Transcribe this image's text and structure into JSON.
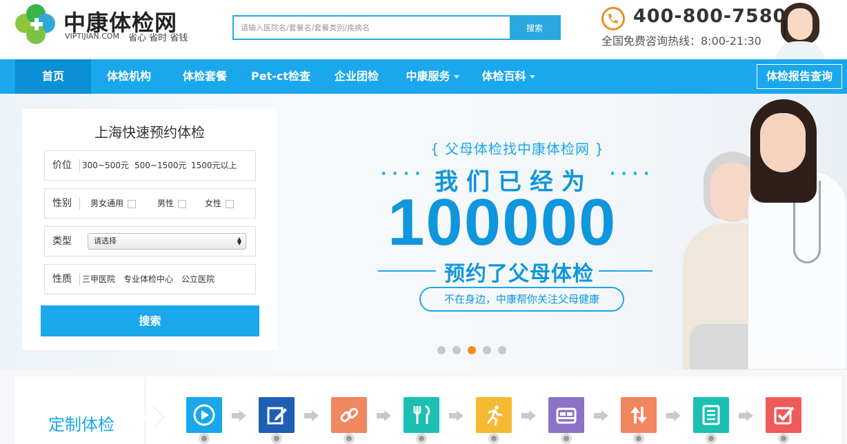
{
  "header": {
    "brand": "中康体检网",
    "domain": "VIPTIJIAN.COM",
    "slogan": "省心 省时 省钱",
    "search_placeholder": "请输入医院名/套餐名/套餐类别/疾病名",
    "search_button": "搜索",
    "phone": "400-800-7580",
    "hotline": "全国免费咨询热线：8:00-21:30"
  },
  "nav": {
    "items": [
      {
        "label": "首页",
        "active": true
      },
      {
        "label": "体检机构"
      },
      {
        "label": "体检套餐"
      },
      {
        "label": "Pet-ct检查"
      },
      {
        "label": "企业团检"
      },
      {
        "label": "中康服务",
        "dropdown": true
      },
      {
        "label": "体检百科",
        "dropdown": true
      }
    ],
    "report_button": "体检报告查询"
  },
  "booking": {
    "title": "上海快速预约体检",
    "price": {
      "label": "价位",
      "options": [
        "300~500元",
        "500~1500元",
        "1500元以上"
      ]
    },
    "gender": {
      "label": "性别",
      "options": [
        "男女通用",
        "男性",
        "女性"
      ]
    },
    "type": {
      "label": "类型",
      "selected": "请选择"
    },
    "nature": {
      "label": "性质",
      "options": [
        "三甲医院",
        "专业体检中心",
        "公立医院"
      ]
    },
    "submit": "搜索"
  },
  "banner": {
    "tagline": "{ 父母体检找中康体检网 }",
    "dots": "····",
    "line1": "我们已经为",
    "number": "100000",
    "line2": "预约了父母体检",
    "pill": "不在身边，中康帮你关注父母健康",
    "slides": 5,
    "active_slide": 3,
    "accent": "#1aa7ec",
    "pager_active_color": "#f08c1e"
  },
  "custom": {
    "title": "定制体检",
    "steps": [
      {
        "icon": "play-icon",
        "color": "#1aa7ec"
      },
      {
        "icon": "edit-icon",
        "color": "#1f5fb4"
      },
      {
        "icon": "link-icon",
        "color": "#f2865e"
      },
      {
        "icon": "dining-icon",
        "color": "#1bbfb4"
      },
      {
        "icon": "running-icon",
        "color": "#f6b932"
      },
      {
        "icon": "bed-icon",
        "color": "#8b72c8"
      },
      {
        "icon": "sort-icon",
        "color": "#f2865e"
      },
      {
        "icon": "document-icon",
        "color": "#1bbfb4"
      },
      {
        "icon": "checkbox-icon",
        "color": "#ef5a5a"
      }
    ]
  }
}
